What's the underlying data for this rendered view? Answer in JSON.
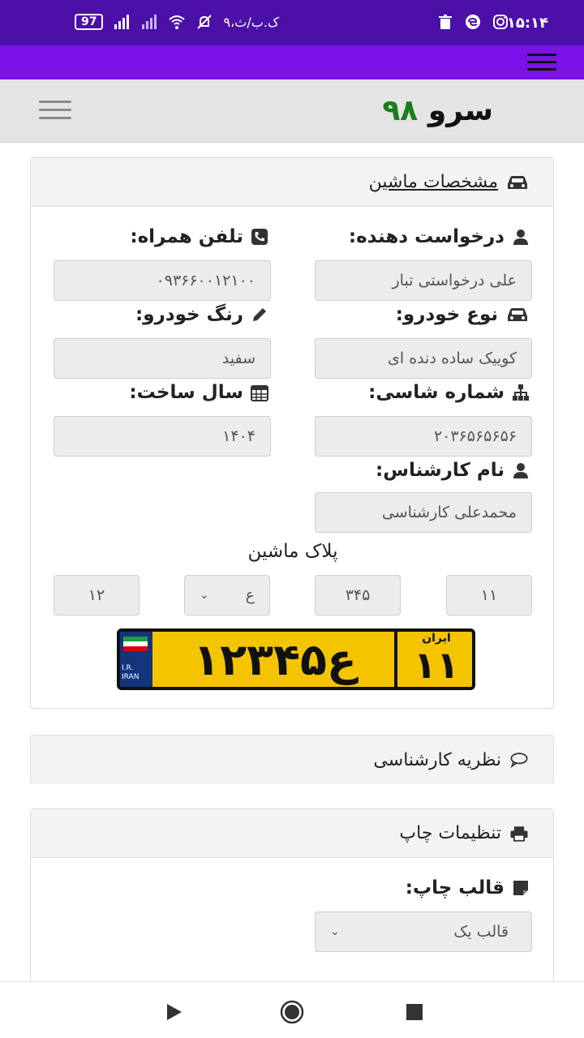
{
  "status_bar": {
    "time": "۱۵:۱۴",
    "network_speed": "۹،ک.ب/ث",
    "battery": "97",
    "icons": [
      "instagram-icon",
      "edge-icon",
      "trash-icon",
      "mute-icon",
      "wifi-icon",
      "signal-icon",
      "signal-icon",
      "battery-icon"
    ]
  },
  "header": {
    "brand_text": "سرو",
    "brand_number": "۹۸"
  },
  "car_card": {
    "title": "مشخصات ماشین",
    "fields": {
      "requester_label": "درخواست دهنده:",
      "requester_value": "علی درخواستی تبار",
      "phone_label": "تلفن همراه:",
      "phone_value": "۰۹۳۶۶۰۰۱۲۱۰۰",
      "car_type_label": "نوع خودرو:",
      "car_type_value": "کوییک ساده دنده ای",
      "car_color_label": "رنگ خودرو:",
      "car_color_value": "سفید",
      "chassis_label": "شماره شاسی:",
      "chassis_value": "۲۰۳۶۵۶۵۶۵۶",
      "year_label": "سال ساخت:",
      "year_value": "۱۴۰۴",
      "expert_label": "نام کارشناس:",
      "expert_value": "محمدعلی کارشناسی"
    },
    "plate": {
      "title": "پلاک ماشین",
      "part1": "۱۱",
      "part2": "۳۴۵",
      "letter": "ع",
      "part4": "۱۲",
      "image_main": "۱۲ع۳۴۵",
      "image_region_label": "ایران",
      "image_region": "۱۱",
      "image_country_code": "I.R.",
      "image_country_name": "IRAN"
    }
  },
  "opinion_card": {
    "title": "نظریه کارشناسی"
  },
  "print_card": {
    "title": "تنظیمات چاپ",
    "template_label": "قالب چاپ:",
    "template_value": "قالب یک"
  },
  "colors": {
    "status_bar": "#4b10a8",
    "app_bar": "#7b12e8",
    "header_bg": "#e4e4e4",
    "brand_number": "#1c7d1c",
    "plate_yellow": "#f4c400",
    "plate_blue": "#12357c"
  }
}
